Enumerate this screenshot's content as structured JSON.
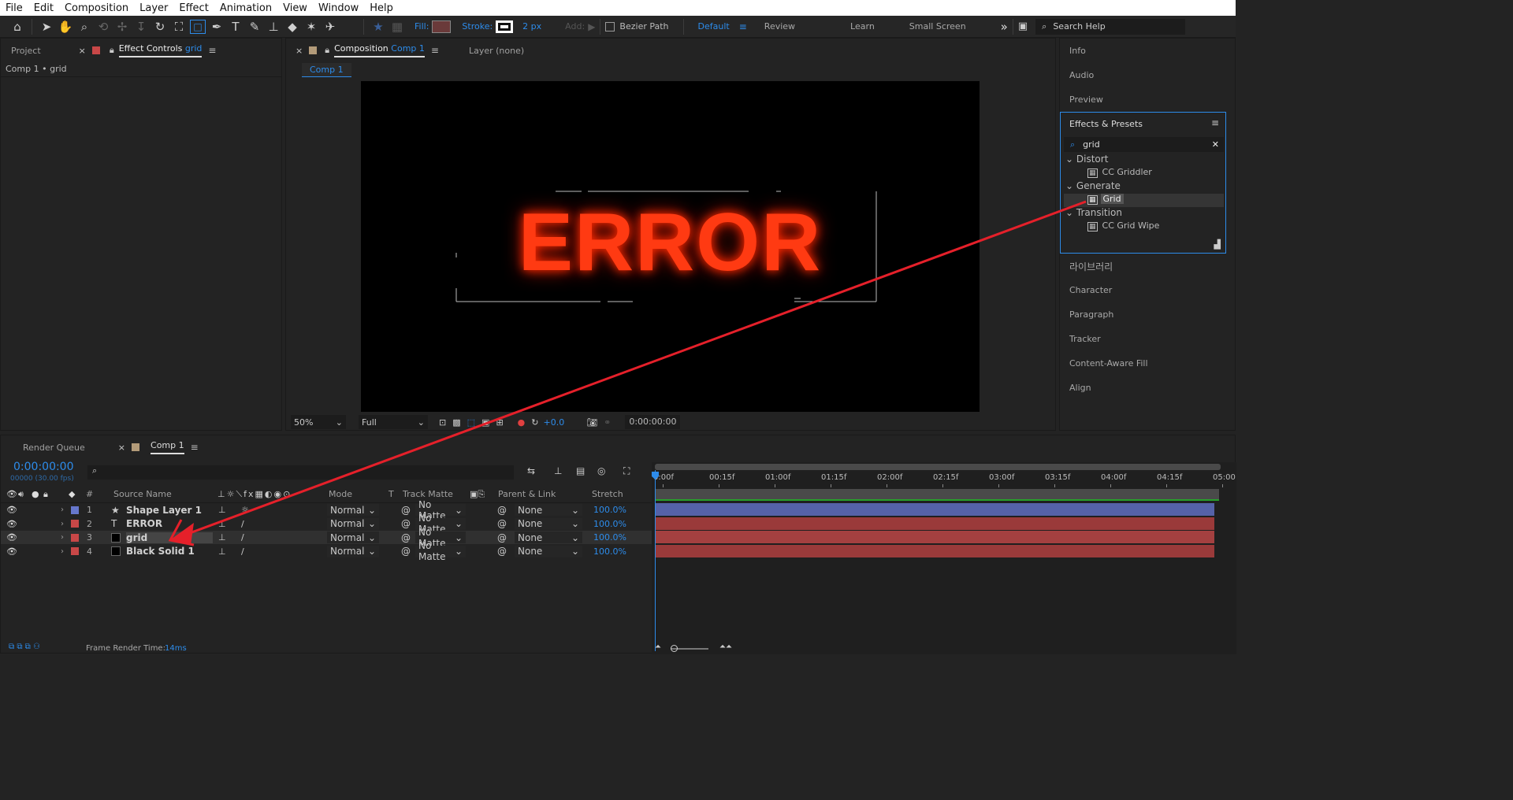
{
  "menu": [
    "File",
    "Edit",
    "Composition",
    "Layer",
    "Effect",
    "Animation",
    "View",
    "Window",
    "Help"
  ],
  "toolbar": {
    "fill_label": "Fill:",
    "stroke_label": "Stroke:",
    "stroke_width": "2 px",
    "add_label": "Add:",
    "bezier_label": "Bezier Path",
    "workspaces": [
      "Default",
      "Review",
      "Learn",
      "Small Screen"
    ],
    "search_placeholder": "Search Help",
    "more_icon": "»"
  },
  "left_panel": {
    "tab_project": "Project",
    "tab_effect_controls": "Effect Controls",
    "tab_effect_layer": "grid",
    "breadcrumb": "Comp 1 • grid"
  },
  "comp_panel": {
    "tab_label": "Composition",
    "tab_comp": "Comp 1",
    "layer_tab": "Layer (none)",
    "sub_tab": "Comp 1",
    "zoom": "50%",
    "resolution": "Full",
    "exposure": "+0.0",
    "timecode": "0:00:00:00",
    "canvas_text": "ERROR"
  },
  "right_panel": {
    "sections_top": [
      "Info",
      "Audio",
      "Preview"
    ],
    "effects_title": "Effects & Presets",
    "search_value": "grid",
    "tree": [
      {
        "category": "Distort",
        "items": [
          "CC Griddler"
        ]
      },
      {
        "category": "Generate",
        "items": [
          "Grid"
        ]
      },
      {
        "category": "Transition",
        "items": [
          "CC Grid Wipe"
        ]
      }
    ],
    "sections_bottom": [
      "라이브러리",
      "Character",
      "Paragraph",
      "Tracker",
      "Content-Aware Fill",
      "Align"
    ]
  },
  "timeline": {
    "tab_render": "Render Queue",
    "tab_comp": "Comp 1",
    "time": "0:00:00:00",
    "fps": "00000 (30.00 fps)",
    "headers": {
      "num": "#",
      "source": "Source Name",
      "mode": "Mode",
      "t": "T",
      "track_matte": "Track Matte",
      "parent": "Parent & Link",
      "stretch": "Stretch"
    },
    "ruler": [
      "0:00f",
      "00:15f",
      "01:00f",
      "01:15f",
      "02:00f",
      "02:15f",
      "03:00f",
      "03:15f",
      "04:00f",
      "04:15f",
      "05:00"
    ],
    "layers": [
      {
        "num": "1",
        "type_icon": "★",
        "name": "Shape Layer 1",
        "mode": "Normal",
        "matte": "No Matte",
        "parent": "None",
        "stretch": "100.0%",
        "color": "#6677cc",
        "bar": "#5562a8"
      },
      {
        "num": "2",
        "type_icon": "T",
        "name": "ERROR",
        "mode": "Normal",
        "matte": "No Matte",
        "parent": "None",
        "stretch": "100.0%",
        "color": "#c84747",
        "bar": "#9a3a3a"
      },
      {
        "num": "3",
        "type_icon": "",
        "name": "grid",
        "mode": "Normal",
        "matte": "No Matte",
        "parent": "None",
        "stretch": "100.0%",
        "color": "#c84747",
        "bar": "#a44040"
      },
      {
        "num": "4",
        "type_icon": "",
        "name": "Black Solid 1",
        "mode": "Normal",
        "matte": "No Matte",
        "parent": "None",
        "stretch": "100.0%",
        "color": "#c84747",
        "bar": "#9a3a3a"
      }
    ]
  },
  "status": {
    "label": "Frame Render Time:",
    "value": "14ms"
  }
}
